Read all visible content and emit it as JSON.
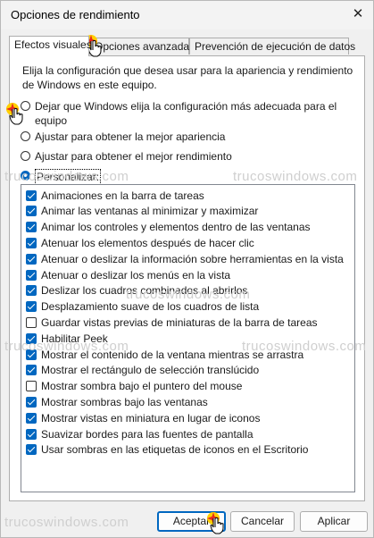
{
  "window": {
    "title": "Opciones de rendimiento",
    "close_symbol": "✕"
  },
  "tabs": [
    {
      "label": "Efectos visuales",
      "active": true
    },
    {
      "label": "Opciones avanzadas",
      "active": false
    },
    {
      "label": "Prevención de ejecución de datos",
      "active": false
    }
  ],
  "intro_text": "Elija la configuración que desea usar para la apariencia y rendimiento de Windows en este equipo.",
  "radios": [
    {
      "label": "Dejar que Windows elija la configuración más adecuada para el equipo",
      "checked": false
    },
    {
      "label": "Ajustar para obtener la mejor apariencia",
      "checked": false
    },
    {
      "label": "Ajustar para obtener el mejor rendimiento",
      "checked": false
    },
    {
      "label": "Personalizar:",
      "checked": true
    }
  ],
  "effects": [
    {
      "label": "Animaciones en la barra de tareas",
      "checked": true
    },
    {
      "label": "Animar las ventanas al minimizar y maximizar",
      "checked": true
    },
    {
      "label": "Animar los controles y elementos dentro de las ventanas",
      "checked": true
    },
    {
      "label": "Atenuar los elementos después de hacer clic",
      "checked": true
    },
    {
      "label": "Atenuar o deslizar la información sobre herramientas en la vista",
      "checked": true
    },
    {
      "label": "Atenuar o deslizar los menús en la vista",
      "checked": true
    },
    {
      "label": "Deslizar los cuadros combinados al abrirlos",
      "checked": true
    },
    {
      "label": "Desplazamiento suave de los cuadros de lista",
      "checked": true
    },
    {
      "label": "Guardar vistas previas de miniaturas de la barra de tareas",
      "checked": false
    },
    {
      "label": "Habilitar Peek",
      "checked": true
    },
    {
      "label": "Mostrar el contenido de la ventana mientras se arrastra",
      "checked": true
    },
    {
      "label": "Mostrar el rectángulo de selección translúcido",
      "checked": true
    },
    {
      "label": "Mostrar sombra bajo el puntero del mouse",
      "checked": false
    },
    {
      "label": "Mostrar sombras bajo las ventanas",
      "checked": true
    },
    {
      "label": "Mostrar vistas en miniatura en lugar de iconos",
      "checked": true
    },
    {
      "label": "Suavizar bordes para las fuentes de pantalla",
      "checked": true
    },
    {
      "label": "Usar sombras en las etiquetas de iconos en el Escritorio",
      "checked": true
    }
  ],
  "buttons": {
    "ok": "Aceptar",
    "cancel": "Cancelar",
    "apply": "Aplicar"
  },
  "watermark": "trucoswindows.com",
  "colors": {
    "accent": "#0067c0",
    "panel_bg": "#ffffff",
    "window_bg": "#f0f0f0"
  }
}
